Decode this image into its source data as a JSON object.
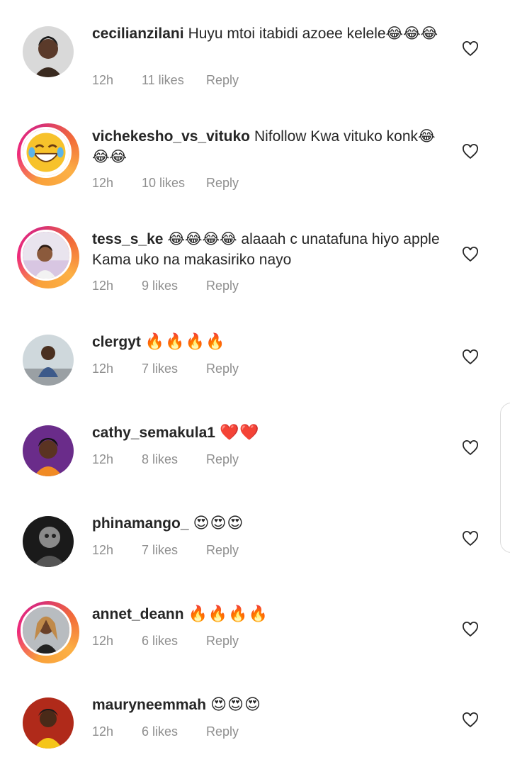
{
  "comments": [
    {
      "username": "cecilianzilani",
      "text": "Huyu mtoi itabidi azoee kelele😂😂😂",
      "time": "12h",
      "likes": "11 likes",
      "reply": "Reply",
      "avatar_icon": "woman-portrait-icon",
      "has_story": false
    },
    {
      "username": "vichekesho_vs_vituko",
      "text": "Nifollow Kwa vituko konk😂😂😂",
      "time": "12h",
      "likes": "10 likes",
      "reply": "Reply",
      "avatar_icon": "laughing-emoji-icon",
      "has_story": true
    },
    {
      "username": "tess_s_ke",
      "text": "😂😂😂😂 alaaah c unatafuna hiyo apple Kama uko na makasiriko nayo",
      "time": "12h",
      "likes": "9 likes",
      "reply": "Reply",
      "avatar_icon": "girl-portrait-icon",
      "has_story": true
    },
    {
      "username": "clergyt",
      "text": "🔥🔥🔥🔥",
      "time": "12h",
      "likes": "7 likes",
      "reply": "Reply",
      "avatar_icon": "person-outdoor-icon",
      "has_story": false
    },
    {
      "username": "cathy_semakula1",
      "text": "❤️❤️",
      "time": "12h",
      "likes": "8 likes",
      "reply": "Reply",
      "avatar_icon": "woman-portrait-icon",
      "has_story": false
    },
    {
      "username": "phinamango_",
      "text": "😍😍😍",
      "time": "12h",
      "likes": "7 likes",
      "reply": "Reply",
      "avatar_icon": "man-bw-portrait-icon",
      "has_story": false
    },
    {
      "username": "annet_deann",
      "text": "🔥🔥🔥🔥",
      "time": "12h",
      "likes": "6 likes",
      "reply": "Reply",
      "avatar_icon": "woman-braids-portrait-icon",
      "has_story": true
    },
    {
      "username": "mauryneemmah",
      "text": "😍😍😍",
      "time": "12h",
      "likes": "6 likes",
      "reply": "Reply",
      "avatar_icon": "woman-yellow-portrait-icon",
      "has_story": false
    }
  ],
  "colors": {
    "text": "#262626",
    "meta": "#8e8e8e",
    "story_ring_start": "#fcb045",
    "story_ring_end": "#ee2a7b"
  }
}
